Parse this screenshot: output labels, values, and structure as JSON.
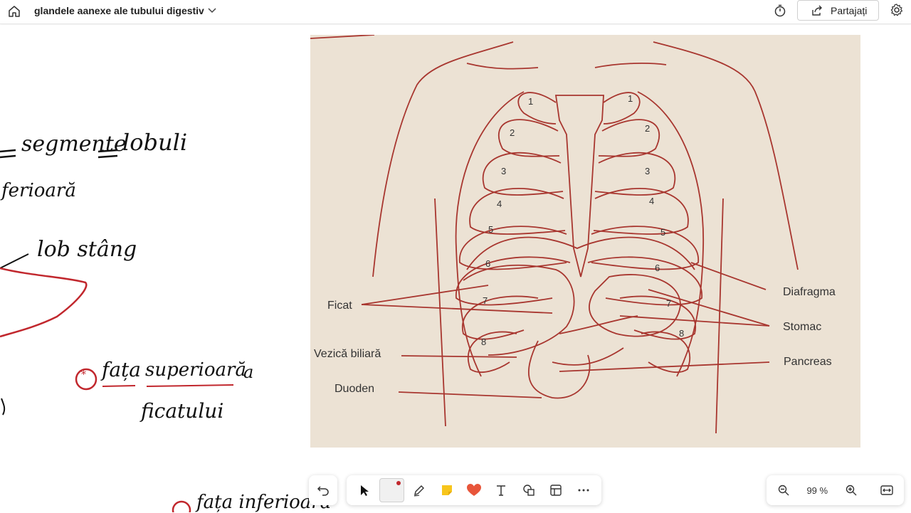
{
  "header": {
    "title": "glandele aanexe ale tubului digestiv",
    "share_label": "Partajați"
  },
  "notes": {
    "segmente": "segmente",
    "lobuli": "lobuli",
    "ferioara": "ferioară",
    "lob_stang": "lob stâng",
    "fata": "fața",
    "superioara": "superioară",
    "a": "a",
    "ficatului": "ficatului",
    "marker_label": "*",
    "bottom_fragment": "fața inferioară"
  },
  "diagram": {
    "labels_left": [
      "Ficat",
      "Vezică biliară",
      "Duoden"
    ],
    "labels_right": [
      "Diafragma",
      "Stomac",
      "Pancreas"
    ],
    "rib_numbers": [
      "1",
      "2",
      "3",
      "4",
      "5",
      "6",
      "7",
      "8"
    ]
  },
  "toolbar": {
    "zoom_level": "99 %"
  },
  "colors": {
    "ink_red": "#c1272d",
    "diagram_line": "#a8362f",
    "photo_bg": "#ece2d4"
  }
}
